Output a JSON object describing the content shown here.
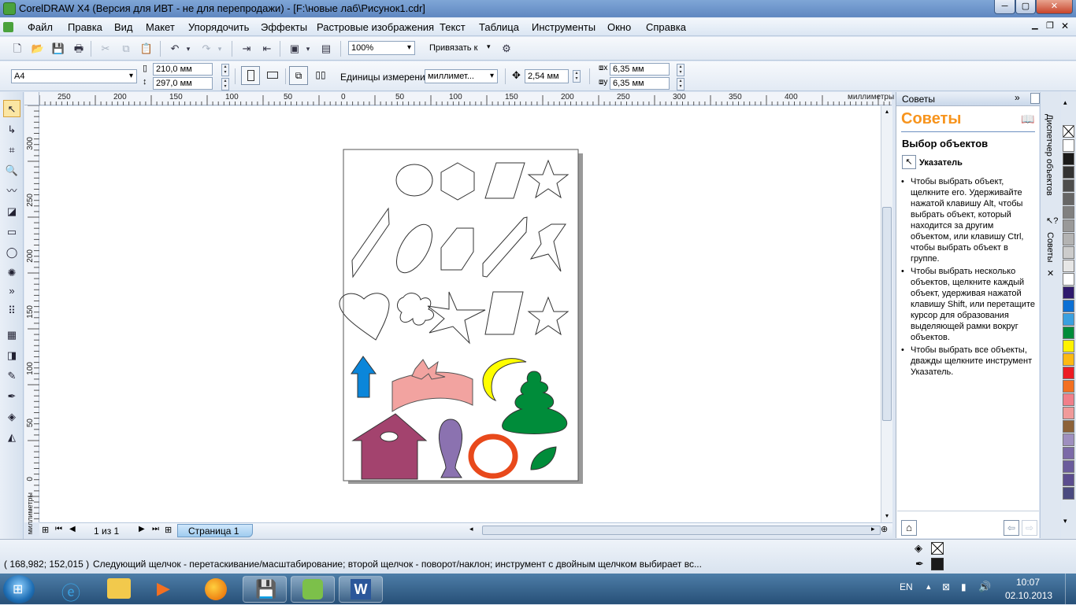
{
  "window": {
    "title": "CorelDRAW X4 (Версия для ИВТ - не для перепродажи) - [F:\\новые лаб\\Рисунок1.cdr]",
    "min": "─",
    "max": "▢",
    "close": "✕"
  },
  "menu": [
    "Файл",
    "Правка",
    "Вид",
    "Макет",
    "Упорядочить",
    "Эффекты",
    "Растровые изображения",
    "Текст",
    "Таблица",
    "Инструменты",
    "Окно",
    "Справка"
  ],
  "toolbar": {
    "zoom": "100%",
    "snap": "Привязать к"
  },
  "propbar": {
    "page_size": "A4",
    "width": "210,0 мм",
    "height": "297,0 мм",
    "units_label": "Единицы измерения:",
    "units": "миллимет...",
    "nudge": "2,54 мм",
    "dup_x": "6,35 мм",
    "dup_y": "6,35 мм"
  },
  "ruler": {
    "h_ticks": [
      "250",
      "200",
      "150",
      "100",
      "50",
      "0",
      "50",
      "100",
      "150",
      "200",
      "250",
      "300",
      "350",
      "400"
    ],
    "h_unit": "миллиметры",
    "v_ticks": [
      "300",
      "250",
      "200",
      "150",
      "100",
      "50",
      "0"
    ],
    "v_unit": "миллиметры"
  },
  "pages": {
    "counter": "1 из 1",
    "tab": "Страница 1"
  },
  "docker": {
    "header": "Советы",
    "title": "Советы",
    "section": "Выбор объектов",
    "tool": "Указатель",
    "tips": [
      "Чтобы выбрать объект, щелкните его. Удерживайте нажатой клавишу Alt, чтобы выбрать объект, который находится за другим объектом, или клавишу Ctrl, чтобы выбрать объект в группе.",
      "Чтобы выбрать несколько объектов, щелкните каждый объект, удерживая нажатой клавишу Shift, или перетащите курсор для образования выделяющей рамки вокруг объектов.",
      "Чтобы выбрать все объекты, дважды щелкните инструмент Указатель."
    ]
  },
  "docker_tabs": {
    "object_manager": "Диспетчер объектов",
    "tips": "Советы"
  },
  "palette": [
    "#ffffff",
    "#1a1a1a",
    "#333333",
    "#4d4d4d",
    "#666666",
    "#808080",
    "#999999",
    "#b3b3b3",
    "#cccccc",
    "#e6e6e6",
    "#ffffff",
    "#2e1a6e",
    "#0b6fd4",
    "#3aa0e0",
    "#008c3a",
    "#fff200",
    "#fdb913",
    "#ec1c24",
    "#f37021",
    "#f07f8a",
    "#f09a9a",
    "#8c6239",
    "#9e8fbf",
    "#7b6aa8",
    "#6a5c9c",
    "#5b4d8f",
    "#4a4a80"
  ],
  "status": {
    "coords": "( 168,982; 152,015 )",
    "message": "Следующий щелчок - перетаскивание/масштабирование; второй щелчок - поворот/наклон; инструмент с двойным щелчком выбирает вс..."
  },
  "tray": {
    "lang": "EN",
    "time": "10:07",
    "date": "02.10.2013"
  }
}
